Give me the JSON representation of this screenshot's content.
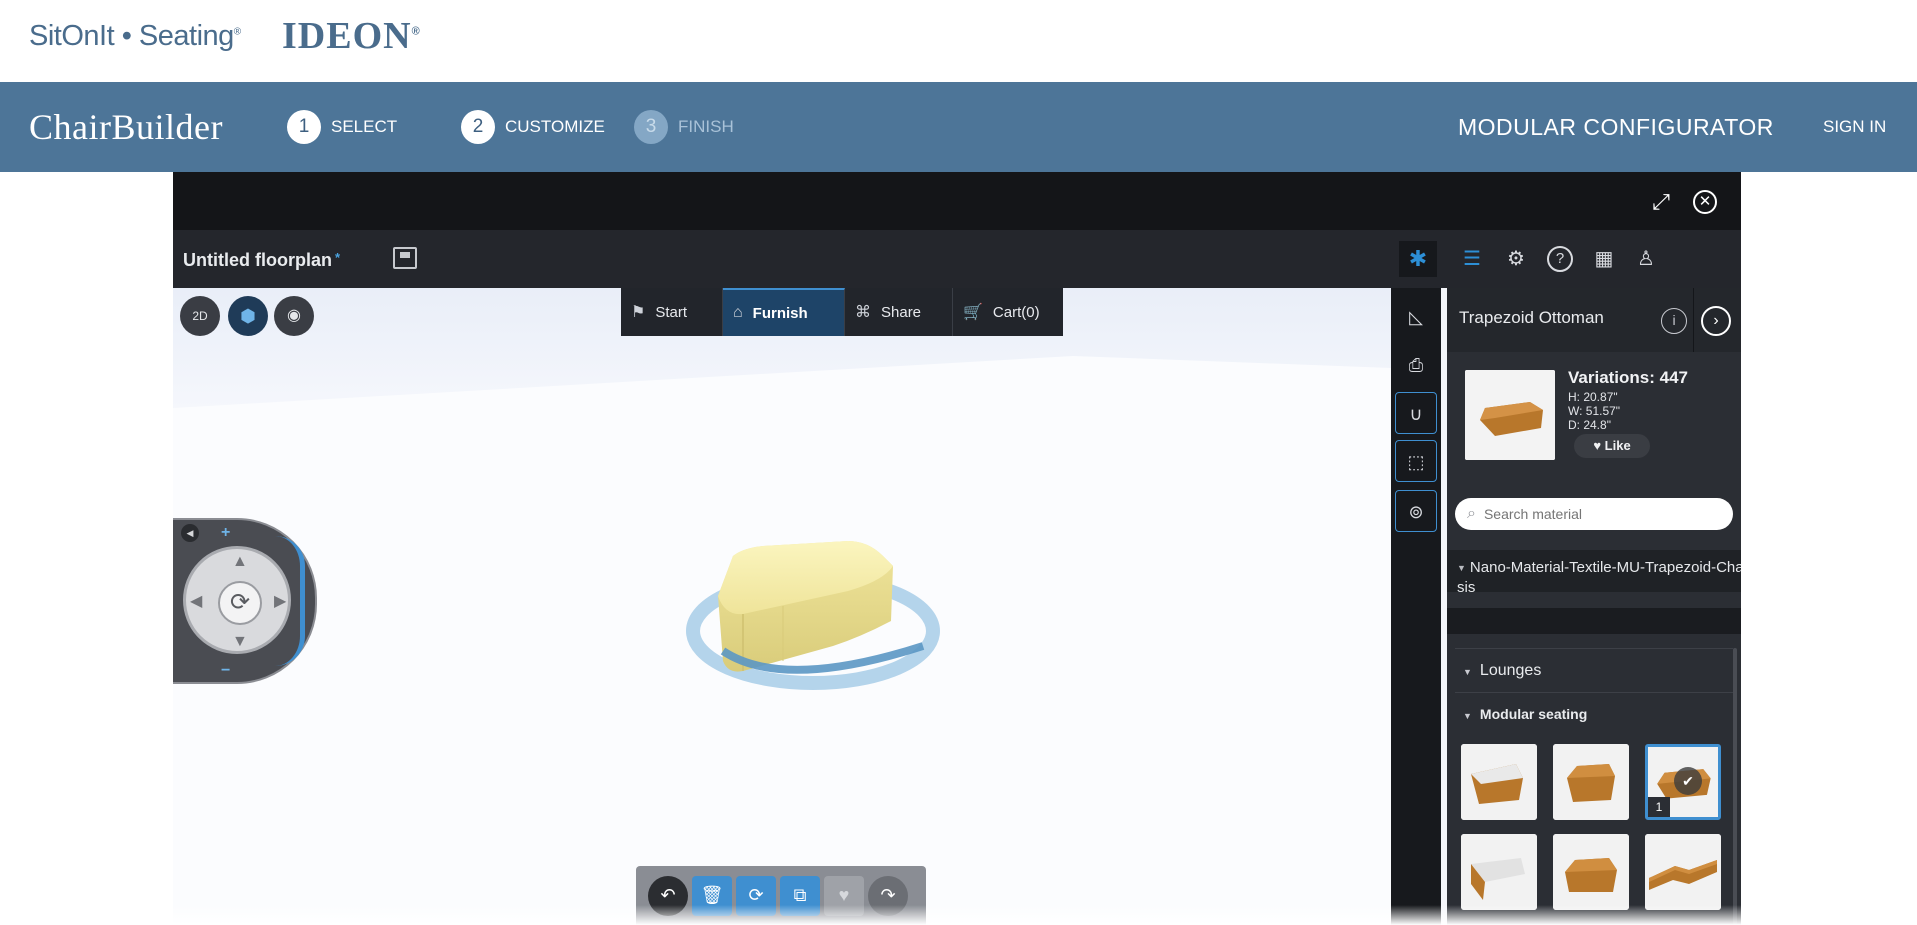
{
  "brand": {
    "sitonit": "SitOnIt • Seating",
    "sitonit_mark": "®",
    "ideon": "IDEON",
    "ideon_mark": "®"
  },
  "nav": {
    "logo": "ChairBuilder",
    "steps": [
      {
        "num": "1",
        "label": "SELECT"
      },
      {
        "num": "2",
        "label": "CUSTOMIZE"
      },
      {
        "num": "3",
        "label": "FINISH"
      }
    ],
    "right_title": "MODULAR CONFIGURATOR",
    "signin": "SIGN IN"
  },
  "app": {
    "floorplan_title": "Untitled floorplan",
    "floorplan_dirty_mark": "*",
    "view_2d": "2D",
    "modes": [
      {
        "label": "Start",
        "icon": "flag-icon"
      },
      {
        "label": "Furnish",
        "icon": "furnish-icon"
      },
      {
        "label": "Share",
        "icon": "share-icon"
      },
      {
        "label": "Cart(0)",
        "icon": "cart-icon"
      }
    ]
  },
  "panel": {
    "product_name": "Trapezoid Ottoman",
    "variations": "Variations: 447",
    "dim_h": "H: 20.87\"",
    "dim_w": "W: 51.57\"",
    "dim_d": "D: 24.8\"",
    "like": "Like",
    "search_placeholder": "Search material",
    "material": "Nano-Material-Textile-MU-Trapezoid-Chassis",
    "category_lounges": "Lounges",
    "category_modular": "Modular seating",
    "selected_tile_count": "1"
  },
  "colors": {
    "nav_blue": "#4d7598",
    "accent": "#3f8fd0",
    "ottoman_fabric": "#f3eba8",
    "wood": "#b8772b"
  }
}
